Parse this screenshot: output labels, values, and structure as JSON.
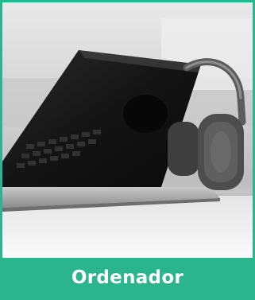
{
  "card": {
    "label": "Ordenador",
    "accent_color": "#2bb58e",
    "image_subject": "laptop-with-headphones-photo"
  }
}
